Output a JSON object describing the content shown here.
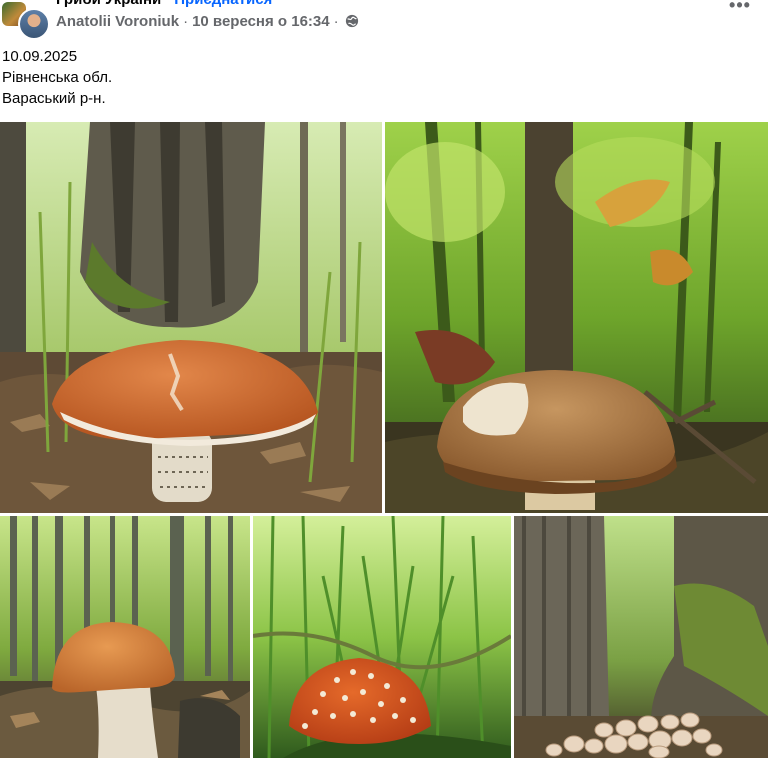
{
  "post": {
    "group_name": "Гриби України",
    "join_label": "Приєднатися",
    "author": "Anatolii Voroniuk",
    "timestamp": "10 вересня о 16:34",
    "more_icon": "ellipsis-icon",
    "privacy_icon": "globe-icon",
    "text_lines": [
      "10.09.2025",
      "Рівненська обл.",
      "Вараський р-н."
    ]
  },
  "photos": [
    {
      "name": "photo-1",
      "subject": "red-cap bolete under oak tree"
    },
    {
      "name": "photo-2",
      "subject": "brown-cap bolete among leaves"
    },
    {
      "name": "photo-3",
      "subject": "orange-cap bolete in birch forest"
    },
    {
      "name": "photo-4",
      "subject": "fly agaric in grass"
    },
    {
      "name": "photo-5",
      "subject": "cluster of honey mushrooms at tree base"
    }
  ]
}
